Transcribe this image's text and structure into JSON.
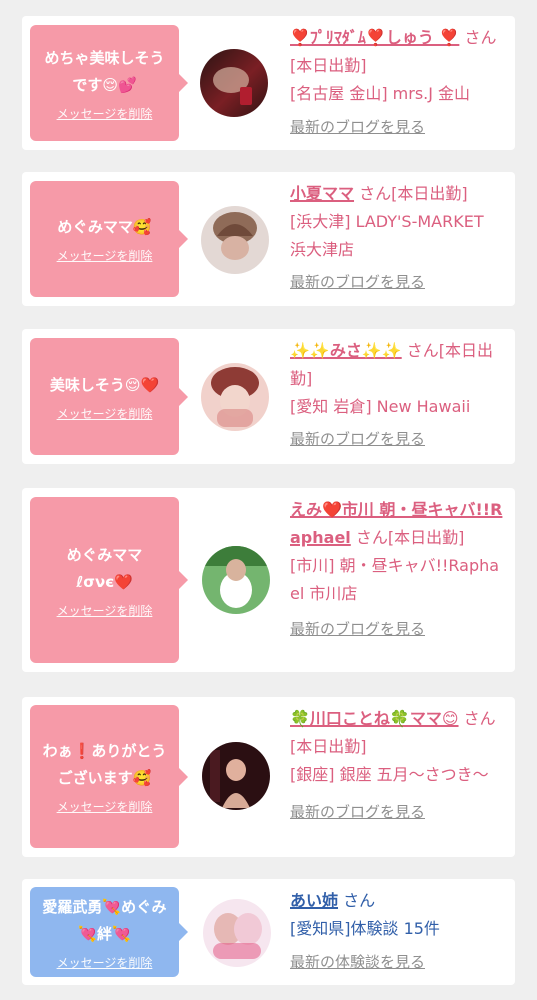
{
  "items": [
    {
      "message": "めちゃ美味しそう\nです😌💕",
      "delete_label": "メッセージを削除",
      "name": "❣️ﾌﾟﾘﾏﾀﾞﾑ❣️しゅう ❣️",
      "suffix": "さん[本日出勤]",
      "location": "[名古屋 金山] mrs.J 金山",
      "link": "最新のブログを見る",
      "avatar_icon": "profile-photo-icon"
    },
    {
      "message": "めぐみママ🥰",
      "delete_label": "メッセージを削除",
      "name": "小夏ママ",
      "suffix": "さん[本日出勤]",
      "location": "[浜大津] LADY'S-MARKET 浜大津店",
      "link": "最新のブログを見る",
      "avatar_icon": "profile-photo-icon"
    },
    {
      "message": "美味しそう😌❤️",
      "delete_label": "メッセージを削除",
      "name": "✨✨みさ✨✨",
      "suffix": "さん[本日出勤]",
      "location": "[愛知 岩倉] New Hawaii",
      "link": "最新のブログを見る",
      "avatar_icon": "profile-photo-icon"
    },
    {
      "message": "めぐみママ\nℓσνє❤️",
      "delete_label": "メッセージを削除",
      "name": "えみ❤️市川 朝・昼キャバ!!Raphael",
      "suffix": "さん[本日出勤]",
      "location": "[市川] 朝・昼キャバ!!Raphael 市川店",
      "link": "最新のブログを見る",
      "avatar_icon": "profile-photo-icon"
    },
    {
      "message": "わぁ❗️ありがとう\nございます🥰",
      "delete_label": "メッセージを削除",
      "name": "🍀川口ことね🍀ママ😊",
      "suffix": "さん[本日出勤]",
      "location": "[銀座] 銀座 五月〜さつき〜",
      "link": "最新のブログを見る",
      "avatar_icon": "profile-photo-icon"
    },
    {
      "message": "愛羅武勇💘めぐみ\n💘絆💘",
      "delete_label": "メッセージを削除",
      "name": "あい姉",
      "suffix": "さん",
      "location": "[愛知県]体験談 15件",
      "link": "最新の体験談を見る",
      "avatar_icon": "profile-photo-icon"
    }
  ],
  "colors": {
    "background": "#efefef",
    "card": "#ffffff",
    "pink_bubble": "#f69aa8",
    "blue_bubble": "#8fb7ef",
    "pink_text": "#db5f7f",
    "blue_text": "#315fa9",
    "link_gray": "#8f8f8f"
  }
}
